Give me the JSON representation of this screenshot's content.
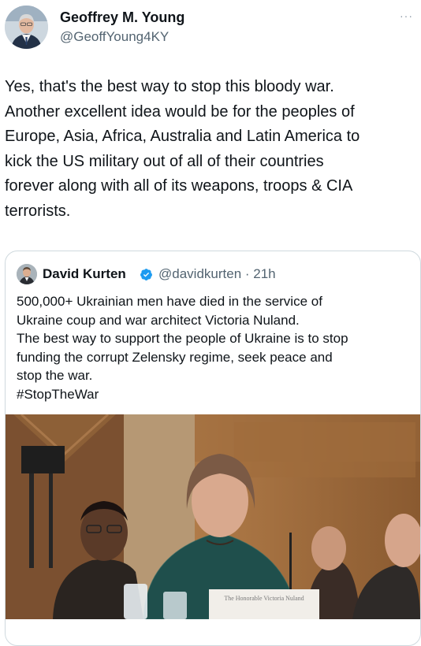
{
  "author": {
    "display_name": "Geoffrey M. Young",
    "handle": "@GeoffYoung4KY"
  },
  "more_label": "···",
  "tweet": {
    "lines": [
      "Yes, that's the best way to stop this bloody war.",
      "Another excellent idea would be for the peoples of",
      "Europe, Asia, Africa, Australia and Latin America to",
      "kick the US military out of all of their countries",
      "forever along with all of its weapons, troops & CIA",
      "terrorists."
    ]
  },
  "quoted": {
    "display_name": "David Kurten",
    "handle": "@davidkurten",
    "separator": "·",
    "time": "21h",
    "meta": "@davidkurten · 21h",
    "lines": [
      "500,000+ Ukrainian men have died in the service of",
      "Ukraine coup and war architect Victoria Nuland.",
      "The best way to support the people of Ukraine is to stop",
      "funding the corrupt Zelensky regime, seek peace and",
      "stop the war.",
      "#StopTheWar"
    ],
    "nameplate_text": "The Honorable Victoria Nuland"
  },
  "colors": {
    "text": "#0f1419",
    "secondary": "#536471",
    "verified_badge": "#1d9bf0",
    "border": "#cfd9de"
  }
}
